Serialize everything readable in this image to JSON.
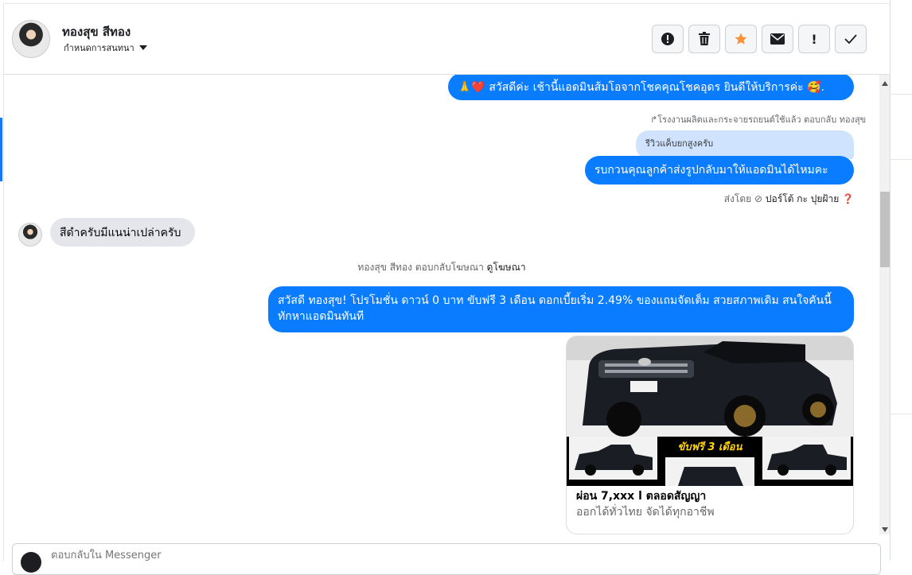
{
  "header": {
    "contact_name": "ทองสุข สีทอง",
    "assign_label": "กำหนดการสนทนา",
    "actions": [
      {
        "name": "alert-button",
        "icon": "exclamation-circle-icon"
      },
      {
        "name": "delete-button",
        "icon": "trash-icon"
      },
      {
        "name": "star-button",
        "icon": "star-icon"
      },
      {
        "name": "mail-button",
        "icon": "envelope-icon"
      },
      {
        "name": "spam-button",
        "icon": "exclamation-icon",
        "label": "!"
      },
      {
        "name": "done-button",
        "icon": "check-icon"
      }
    ]
  },
  "messages": {
    "m1_text": "🙏❤️ สวัสดีค่ะ เช้านี้แอดมินส้มโอจากโชคคุณโชคอุดร ยินดีให้บริการค่ะ 🥰.",
    "reply_meta": "โรงงานผลิตและกระจายรถยนต์ใช้แล้ว ตอบกลับ ทองสุข",
    "reply_quote": "รีวิวแค็บยกสูงครับ",
    "m2_text": "รบกวนคุณลูกค้าส่งรูปกลับมาให้แอดมินได้ไหมคะ",
    "sent_by": "ส่งโดย",
    "sent_by_name": "ปอร์โต้ กะ ปุยฝ้าย",
    "incoming_text": "สีดำครับมีแนน่าเปล่าครับ",
    "ad_reply_meta": "ทองสุข สีทอง ตอบกลับโฆษณา",
    "ad_link": "ดูโฆษณา",
    "promo_text": "สวัสดี ทองสุข! โปรโมชั่น ดาวน์ 0 บาท ขับฟรี 3 เดือน ดอกเบี้ยเริ่ม 2.49% ของแถมจัดเต็ม สวยสภาพเดิม สนใจคันนี้ทักหาแอดมินทันที"
  },
  "card": {
    "banner_text": "ขับฟรี 3 เดือน",
    "title": "ผ่อน 7,xxx l ตลอดสัญญา",
    "subtitle": "ออกได้ทั่วไทย จัดได้ทุกอาชีพ"
  },
  "composer": {
    "placeholder": "ตอบกลับใน Messenger"
  },
  "colors": {
    "outgoing": "#0a7cff",
    "incoming": "#e4e6eb",
    "star": "#f7923b"
  }
}
